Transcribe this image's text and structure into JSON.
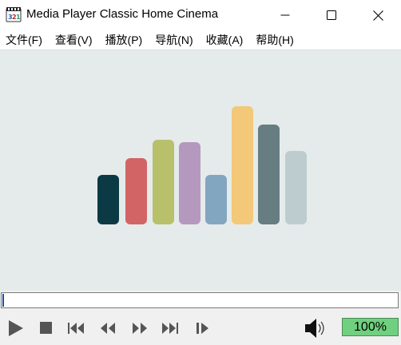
{
  "window": {
    "title": "Media Player Classic Home Cinema",
    "app_icon": "mpc-hc-film-icon",
    "controls": [
      "minimize-icon",
      "maximize-icon",
      "close-icon"
    ]
  },
  "menu": {
    "items": [
      {
        "label": "文件(F)"
      },
      {
        "label": "查看(V)"
      },
      {
        "label": "播放(P)"
      },
      {
        "label": "导航(N)"
      },
      {
        "label": "收藏(A)"
      },
      {
        "label": "帮助(H)"
      }
    ]
  },
  "video_area": {
    "background_color": "#e5ebeb",
    "logo_bar_colors": [
      "#0b3a45",
      "#d26465",
      "#b8c06c",
      "#b598bd",
      "#82a6c0",
      "#f3c878",
      "#667d82",
      "#bdcdcf"
    ]
  },
  "seekbar": {
    "position_fraction": 0
  },
  "controls": {
    "buttons": [
      "play-icon",
      "stop-icon",
      "skip-back-icon",
      "rewind-icon",
      "fast-forward-icon",
      "skip-forward-icon",
      "frame-step-icon"
    ],
    "volume_icon": "speaker-icon",
    "volume_label": "100%",
    "volume_color": "#6fd07f"
  }
}
